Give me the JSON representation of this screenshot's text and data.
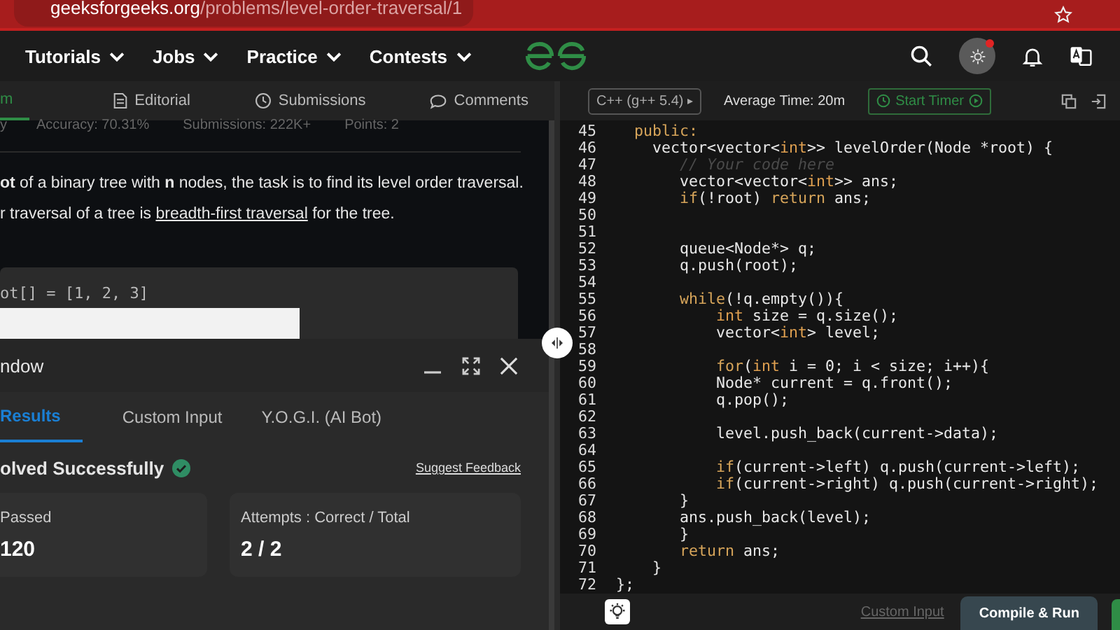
{
  "browser": {
    "domain": "geeksforgeeks.org",
    "path": "/problems/level-order-traversal/1"
  },
  "nav": {
    "items": [
      {
        "label": "Tutorials"
      },
      {
        "label": "Jobs"
      },
      {
        "label": "Practice"
      },
      {
        "label": "Contests"
      }
    ],
    "notification_dot": true
  },
  "problem_tabs": [
    {
      "label": "m",
      "kind": "plain",
      "selected": true
    },
    {
      "label": "Editorial",
      "kind": "doc",
      "selected": false
    },
    {
      "label": "Submissions",
      "kind": "clock",
      "selected": false
    },
    {
      "label": "Comments",
      "kind": "chat",
      "selected": false
    }
  ],
  "stats": [
    "y",
    "Accuracy: 70.31%",
    "Submissions: 222K+",
    "Points: 2"
  ],
  "description": {
    "sentence": "**ot** of a binary tree with **n** nodes, the task is to find its level order traversal.",
    "before": "r traversal of a tree is ",
    "link": "breadth-first traversal",
    "after": " for the tree."
  },
  "example": {
    "input": "ot[] = [1,  2,  3]"
  },
  "result_window": {
    "title": "ndow",
    "tabs": [
      {
        "label": "Results",
        "selected": true
      },
      {
        "label": "Custom Input",
        "selected": false
      },
      {
        "label": "Y.O.G.I. (AI Bot)",
        "selected": false
      }
    ],
    "status": "olved Successfully",
    "solved": true,
    "feedback_link": "Suggest Feedback",
    "cards": [
      {
        "label": "Passed",
        "value": "120"
      },
      {
        "label": "Attempts : Correct / Total",
        "value": "2 / 2"
      }
    ]
  },
  "editor": {
    "language": "C++ (g++ 5.4)",
    "average_time": "Average Time: 20m",
    "timer_button": "Start Timer",
    "lines": [
      {
        "number": "45",
        "code": [
          {
            "kind": "keyword",
            "text": "  public:"
          }
        ]
      },
      {
        "number": "46",
        "code": [
          {
            "kind": "plain",
            "text": "    vector<vector<"
          },
          {
            "kind": "type",
            "text": "int"
          },
          {
            "kind": "plain",
            "text": ">> levelOrder(Node *root) {"
          }
        ]
      },
      {
        "number": "47",
        "code": [
          {
            "kind": "comment",
            "text": "       // Your code here"
          }
        ]
      },
      {
        "number": "48",
        "code": [
          {
            "kind": "plain",
            "text": "       vector<vector<"
          },
          {
            "kind": "type",
            "text": "int"
          },
          {
            "kind": "plain",
            "text": ">> ans;"
          }
        ]
      },
      {
        "number": "49",
        "code": [
          {
            "kind": "keyword",
            "text": "       if"
          },
          {
            "kind": "plain",
            "text": "(!root) "
          },
          {
            "kind": "keyword",
            "text": "return"
          },
          {
            "kind": "plain",
            "text": " ans;"
          }
        ]
      },
      {
        "number": "50"
      },
      {
        "number": "51"
      },
      {
        "number": "52",
        "code": [
          {
            "kind": "plain",
            "text": "       queue<Node*> q;"
          }
        ]
      },
      {
        "number": "53",
        "code": [
          {
            "kind": "plain",
            "text": "       q.push(root);"
          }
        ]
      },
      {
        "number": "54"
      },
      {
        "number": "55",
        "code": [
          {
            "kind": "keyword",
            "text": "       while"
          },
          {
            "kind": "plain",
            "text": "(!q.empty()){"
          }
        ]
      },
      {
        "number": "56",
        "code": [
          {
            "kind": "type",
            "text": "           int"
          },
          {
            "kind": "plain",
            "text": " size = q.size();"
          }
        ]
      },
      {
        "number": "57",
        "code": [
          {
            "kind": "plain",
            "text": "           vector<"
          },
          {
            "kind": "type",
            "text": "int"
          },
          {
            "kind": "plain",
            "text": "> level;"
          }
        ]
      },
      {
        "number": "58"
      },
      {
        "number": "59",
        "code": [
          {
            "kind": "keyword",
            "text": "           for"
          },
          {
            "kind": "plain",
            "text": "("
          },
          {
            "kind": "type",
            "text": "int"
          },
          {
            "kind": "plain",
            "text": " i = 0; i < size; i++){"
          }
        ]
      },
      {
        "number": "60",
        "code": [
          {
            "kind": "plain",
            "text": "           Node* current = q.front();"
          }
        ]
      },
      {
        "number": "61",
        "code": [
          {
            "kind": "plain",
            "text": "           q.pop();"
          }
        ]
      },
      {
        "number": "62"
      },
      {
        "number": "63",
        "code": [
          {
            "kind": "plain",
            "text": "           level.push_back(current->data);"
          }
        ]
      },
      {
        "number": "64"
      },
      {
        "number": "65",
        "code": [
          {
            "kind": "keyword",
            "text": "           if"
          },
          {
            "kind": "plain",
            "text": "(current->left) q.push(current->left);"
          }
        ]
      },
      {
        "number": "66",
        "code": [
          {
            "kind": "keyword",
            "text": "           if"
          },
          {
            "kind": "plain",
            "text": "(current->right) q.push(current->right);"
          }
        ]
      },
      {
        "number": "67",
        "code": [
          {
            "kind": "plain",
            "text": "       }"
          }
        ]
      },
      {
        "number": "68",
        "code": [
          {
            "kind": "plain",
            "text": "       ans.push_back(level);"
          }
        ]
      },
      {
        "number": "69",
        "code": [
          {
            "kind": "plain",
            "text": "       }"
          }
        ]
      },
      {
        "number": "70",
        "code": [
          {
            "kind": "keyword",
            "text": "       return"
          },
          {
            "kind": "plain",
            "text": " ans;"
          }
        ]
      },
      {
        "number": "71",
        "code": [
          {
            "kind": "plain",
            "text": "    }"
          }
        ]
      },
      {
        "number": "72",
        "code": [
          {
            "kind": "plain",
            "text": "};"
          }
        ]
      }
    ],
    "custom_input": "Custom Input",
    "compile_button": "Compile & Run"
  }
}
